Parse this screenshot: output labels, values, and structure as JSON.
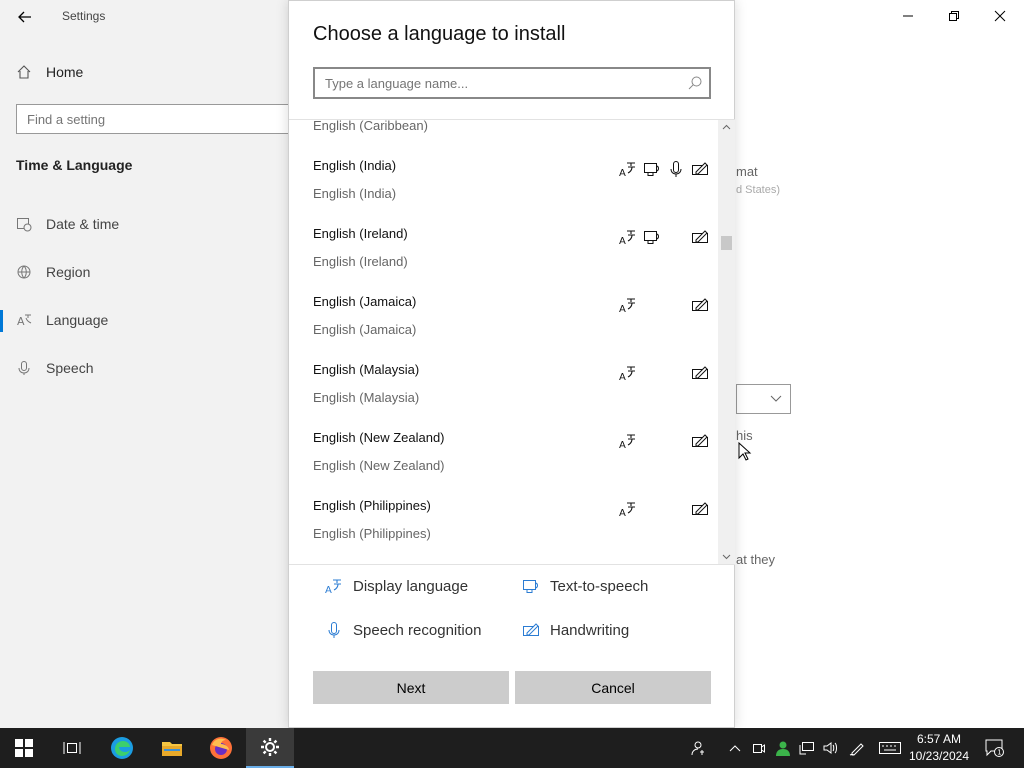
{
  "settings": {
    "app_title": "Settings",
    "home_label": "Home",
    "search_placeholder": "Find a setting",
    "section_title": "Time & Language",
    "nav": [
      {
        "label": "Date & time",
        "icon": "calendar-clock-icon"
      },
      {
        "label": "Region",
        "icon": "globe-icon"
      },
      {
        "label": "Language",
        "icon": "language-icon",
        "active": true
      },
      {
        "label": "Speech",
        "icon": "microphone-icon"
      }
    ],
    "bg_fragments": {
      "format": "mat",
      "region_hint": "d States)",
      "this": "his",
      "they": "at they"
    }
  },
  "dialog": {
    "title": "Choose a language to install",
    "search_placeholder": "Type a language name...",
    "partial_item": "English (Caribbean)",
    "languages": [
      {
        "name": "English (India)",
        "native": "English (India)",
        "features": [
          "display-language",
          "text-to-speech",
          "speech-recognition",
          "handwriting"
        ]
      },
      {
        "name": "English (Ireland)",
        "native": "English (Ireland)",
        "features": [
          "display-language",
          "text-to-speech",
          "handwriting"
        ]
      },
      {
        "name": "English (Jamaica)",
        "native": "English (Jamaica)",
        "features": [
          "display-language",
          "handwriting"
        ]
      },
      {
        "name": "English (Malaysia)",
        "native": "English (Malaysia)",
        "features": [
          "display-language",
          "handwriting"
        ]
      },
      {
        "name": "English (New Zealand)",
        "native": "English (New Zealand)",
        "features": [
          "display-language",
          "handwriting"
        ]
      },
      {
        "name": "English (Philippines)",
        "native": "English (Philippines)",
        "features": [
          "display-language",
          "handwriting"
        ]
      }
    ],
    "legend": {
      "display_language": "Display language",
      "text_to_speech": "Text-to-speech",
      "speech_recognition": "Speech recognition",
      "handwriting": "Handwriting"
    },
    "next_label": "Next",
    "cancel_label": "Cancel"
  },
  "taskbar": {
    "time": "6:57 AM",
    "date": "10/23/2024",
    "notification_count": "1",
    "accent": "#6aaee8"
  }
}
